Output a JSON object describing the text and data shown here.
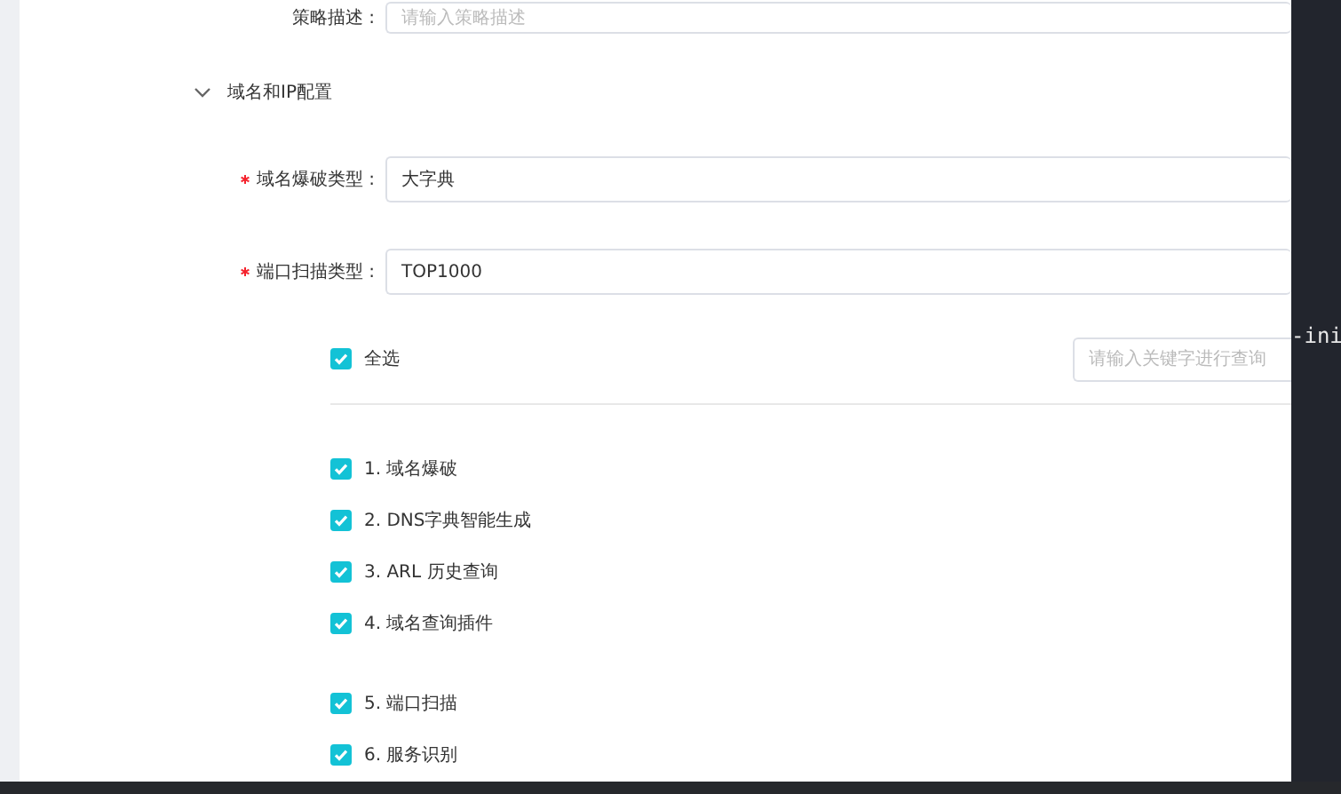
{
  "top_field": {
    "label": "策略描述 :",
    "placeholder": "请输入策略描述"
  },
  "section": {
    "title": "域名和IP配置",
    "expanded": true
  },
  "fields": [
    {
      "label": "域名爆破类型 :",
      "required": true,
      "value": "大字典"
    },
    {
      "label": "端口扫描类型 :",
      "required": true,
      "value": "TOP1000"
    }
  ],
  "select_all": {
    "label": "全选",
    "checked": true
  },
  "search": {
    "placeholder": "请输入关键字进行查询"
  },
  "option_groups": [
    [
      {
        "label": "1. 域名爆破",
        "checked": true
      },
      {
        "label": "2. DNS字典智能生成",
        "checked": true
      },
      {
        "label": "3. ARL 历史查询",
        "checked": true
      },
      {
        "label": "4. 域名查询插件",
        "checked": true
      }
    ],
    [
      {
        "label": "5. 端口扫描",
        "checked": true
      },
      {
        "label": "6. 服务识别",
        "checked": true
      }
    ]
  ],
  "terminal": {
    "text": "-ini"
  }
}
